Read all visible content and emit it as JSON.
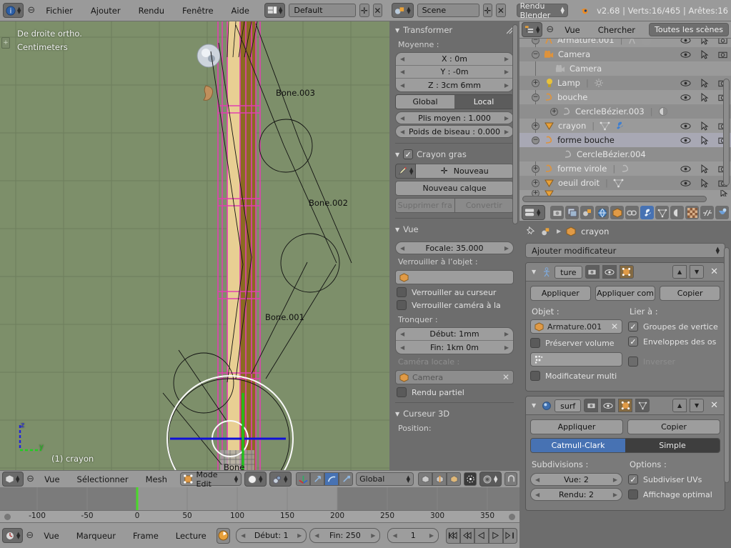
{
  "window": {
    "version_info": "v2.68 | Verts:16/465 | Arêtes:16",
    "screen_layout": "Default",
    "scene_name": "Scene",
    "render_engine": "Rendu Blender",
    "menus": [
      "Fichier",
      "Ajouter",
      "Rendu",
      "Fenêtre",
      "Aide"
    ],
    "icons": {
      "info": "info-editor-icon",
      "layout": "screen-layout-icon",
      "scene": "scene-icon",
      "blender": "blender-logo-icon",
      "add": "plus-icon",
      "close": "x-icon"
    }
  },
  "viewport": {
    "view_label": "De droite ortho.",
    "units_label": "Centimeters",
    "object_label": "(1) crayon",
    "axis_z": "z",
    "axis_y": "y",
    "bone_labels": [
      "Bone.003",
      "Bone.002",
      "Bone.001",
      "Bone"
    ],
    "colors": {
      "background": "#7d8f6a",
      "grid": "#6e7f5d",
      "selection": "#e040b0",
      "active": "#f0d090",
      "axis_z": "#2020d8",
      "axis_y": "#20c020"
    }
  },
  "viewport_header": {
    "editor_type": "3d-view-icon",
    "menus": [
      "Vue",
      "Sélectionner",
      "Mesh"
    ],
    "mode": "Mode Edit",
    "transform_orientation": "Global",
    "icons": {
      "mode": "edit-mode-icon",
      "shading": "shading-sphere-icon",
      "pivot": "pivot-icon",
      "manipulator": "manipulator-axis-icon",
      "translate": "translate-arrow-icon",
      "rotate": "rotate-arc-icon",
      "scale": "scale-icon",
      "vertex_select": "vertex-select-icon",
      "edge_select": "edge-select-icon",
      "face_select": "face-select-icon",
      "proportional": "proportional-edit-icon",
      "falloff": "falloff-icon",
      "snap": "snap-magnet-icon"
    }
  },
  "npanel": {
    "transform": {
      "title": "Transformer",
      "median_label": "Moyenne :",
      "fields": [
        {
          "label": "X  : 0m"
        },
        {
          "label": "Y  : -0m"
        },
        {
          "label": "Z  : 3cm 6mm"
        }
      ],
      "space_options": [
        "Global",
        "Local"
      ],
      "space_selected": "Local",
      "crease": "Plis moyen  : 1.000",
      "bevel_weight": "Poids de biseau : 0.000"
    },
    "grease_pencil": {
      "title": "Crayon gras",
      "new_button": "Nouveau",
      "new_layer_button": "Nouveau calque",
      "delete_frame_button": "Supprimer fra",
      "convert_button": "Convertir",
      "icons": {
        "pencil": "pencil-icon",
        "plus": "plus-icon"
      }
    },
    "view": {
      "title": "Vue",
      "lens": "Focale: 35.000",
      "lock_object_label": "Verrouiller à l’objet  :",
      "lock_object_value": "",
      "lock_cursor": "Verrouiller au curseur",
      "lock_camera": "Verrouiller caméra à la",
      "clip_label": "Tronquer  :",
      "clip_start": "Début: 1mm",
      "clip_end": "Fin: 1km 0m",
      "local_camera_label": "Caméra locale  :",
      "local_camera_value": "Camera",
      "render_border": "Rendu partiel"
    },
    "cursor": {
      "title": "Curseur 3D",
      "position_label": "Position:"
    }
  },
  "timeline": {
    "editor_type": "timeline-icon",
    "menus": [
      "Vue",
      "Marqueur",
      "Frame",
      "Lecture"
    ],
    "auto_key_icon": "record-icon",
    "start": "Début: 1",
    "end": "Fin: 250",
    "current_frame": "1",
    "ticks": [
      "-100",
      "-50",
      "0",
      "50",
      "100",
      "150",
      "200",
      "250",
      "300",
      "350"
    ],
    "playhead_frame": "1",
    "transport": [
      "jump-start-icon",
      "prev-keyframe-icon",
      "play-reverse-icon",
      "play-icon",
      "jump-end-icon"
    ]
  },
  "outliner": {
    "editor_type": "outliner-icon",
    "menus": [
      "Vue",
      "Chercher"
    ],
    "display_mode": "Toutes les scènes",
    "rows": [
      {
        "name": "Armature.001",
        "indent": 1,
        "expander": "-",
        "icon": "armature-icon",
        "datatype": "armature-data-icon",
        "cut": true,
        "restricts": true,
        "alt": false
      },
      {
        "name": "Camera",
        "indent": 1,
        "expander": "-",
        "icon": "camera-icon",
        "restricts": true,
        "alt": true
      },
      {
        "name": "Camera",
        "indent": 2,
        "expander": "",
        "icon": "camera-data-icon",
        "restricts": false,
        "alt": false
      },
      {
        "name": "Lamp",
        "indent": 1,
        "expander": "+",
        "icon": "lamp-icon",
        "datatype": "lamp-data-icon",
        "restricts": true,
        "alt": true
      },
      {
        "name": "bouche",
        "indent": 1,
        "expander": "-",
        "icon": "curve-icon",
        "restricts": true,
        "alt": false
      },
      {
        "name": "CercleBézier.003",
        "indent": 2,
        "expander": "+",
        "icon": "curve-data-icon",
        "datatype": "material-icon",
        "restricts": false,
        "alt": true
      },
      {
        "name": "crayon",
        "indent": 1,
        "expander": "+",
        "icon": "mesh-icon",
        "datatype": "mesh-data-icon",
        "datatype2": "modifier-wrench-icon",
        "restricts": true,
        "alt": false
      },
      {
        "name": "forme bouche",
        "indent": 1,
        "expander": "-",
        "icon": "curve-icon",
        "restricts": true,
        "alt": false,
        "selected": true
      },
      {
        "name": "CercleBézier.004",
        "indent": 2,
        "expander": "",
        "icon": "curve-data-icon",
        "restricts": false,
        "alt": true
      },
      {
        "name": "forme virole",
        "indent": 1,
        "expander": "+",
        "icon": "curve-icon",
        "datatype": "curve-data-icon",
        "restricts": true,
        "alt": false
      },
      {
        "name": "oeuil droit",
        "indent": 1,
        "expander": "+",
        "icon": "mesh-icon",
        "datatype": "mesh-data-icon",
        "restricts": true,
        "alt": true
      },
      {
        "name": "",
        "indent": 1,
        "expander": "+",
        "icon": "mesh-icon",
        "restricts": true,
        "alt": false
      }
    ]
  },
  "properties": {
    "editor_type": "properties-icon",
    "tabs": [
      {
        "name": "render-tab",
        "icon": "camera-back-icon",
        "active": false
      },
      {
        "name": "render-layers-tab",
        "icon": "images-icon",
        "active": false
      },
      {
        "name": "scene-tab",
        "icon": "scene-cone-icon",
        "active": false
      },
      {
        "name": "world-tab",
        "icon": "world-globe-icon",
        "active": false
      },
      {
        "name": "object-tab",
        "icon": "object-cube-icon",
        "active": false
      },
      {
        "name": "constraints-tab",
        "icon": "chain-link-icon",
        "active": false
      },
      {
        "name": "modifiers-tab",
        "icon": "wrench-icon",
        "active": true
      },
      {
        "name": "data-tab",
        "icon": "triangle-data-icon",
        "active": false
      },
      {
        "name": "material-tab",
        "icon": "material-sphere-icon",
        "active": false
      },
      {
        "name": "texture-tab",
        "icon": "checker-texture-icon",
        "active": false
      },
      {
        "name": "particles-tab",
        "icon": "particles-icon",
        "active": false
      },
      {
        "name": "physics-tab",
        "icon": "physics-icon",
        "active": false
      }
    ],
    "breadcrumb_object": "crayon",
    "add_modifier": "Ajouter modificateur",
    "modifiers": [
      {
        "type": "armature",
        "name": "ture",
        "icon": "armature-modifier-icon",
        "apply": "Appliquer",
        "apply_as": "Appliquer com",
        "copy": "Copier",
        "object_label": "Objet  :",
        "object_value": "Armature.001",
        "bind_label": "Lier à  :",
        "vertex_groups": "Groupes de vertice",
        "vertex_groups_checked": true,
        "bone_envelopes": "Enveloppes des os",
        "bone_envelopes_checked": true,
        "preserve_volume": "Préserver volume",
        "preserve_volume_checked": false,
        "invert": "Inverser",
        "invert_checked": false,
        "multi_modifier": "Modificateur multi",
        "multi_modifier_checked": false,
        "vertex_group_value": ""
      },
      {
        "type": "subsurf",
        "name": "surf",
        "icon": "subsurf-modifier-icon",
        "apply": "Appliquer",
        "copy": "Copier",
        "algorithms": [
          "Catmull-Clark",
          "Simple"
        ],
        "algorithm_selected": "Catmull-Clark",
        "subdivisions_label": "Subdivisions  :",
        "view": "Vue: 2",
        "render": "Rendu: 2",
        "options_label": "Options  :",
        "subdivide_uvs": "Subdiviser UVs",
        "subdivide_uvs_checked": true,
        "optimal_display": "Affichage optimal",
        "optimal_display_checked": false
      }
    ],
    "accent_color": "#4772b3"
  }
}
